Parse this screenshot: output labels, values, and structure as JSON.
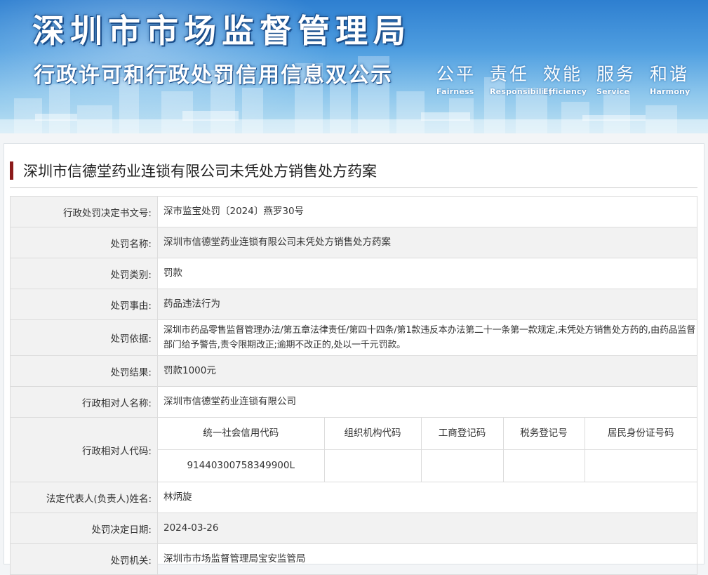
{
  "banner": {
    "title": "深圳市市场监督管理局",
    "subtitle": "行政许可和行政处罚信用信息双公示",
    "motto": [
      {
        "zh": "公平",
        "en": "Fairness"
      },
      {
        "zh": "责任",
        "en": "Responsibility"
      },
      {
        "zh": "效能",
        "en": "Efficiency"
      },
      {
        "zh": "服务",
        "en": "Service"
      },
      {
        "zh": "和谐",
        "en": "Harmony"
      }
    ]
  },
  "heading": "深圳市信德堂药业连锁有限公司未凭处方销售处方药案",
  "colors": {
    "accent_bar": "#8b1a1a",
    "label_bg": "#f2f2f2",
    "border": "#dcdcdc"
  },
  "rows": {
    "doc_no": {
      "label": "行政处罚决定书文号:",
      "value": "深市监宝处罚〔2024〕燕罗30号"
    },
    "name": {
      "label": "处罚名称:",
      "value": "深圳市信德堂药业连锁有限公司未凭处方销售处方药案"
    },
    "category": {
      "label": "处罚类别:",
      "value": "罚款"
    },
    "reason": {
      "label": "处罚事由:",
      "value": "药品违法行为"
    },
    "basis": {
      "label": "处罚依据:",
      "value": "深圳市药品零售监督管理办法/第五章法律责任/第四十四条/第1款违反本办法第二十一条第一款规定,未凭处方销售处方药的,由药品监督部门给予警告,责令限期改正;逾期不改正的,处以一千元罚款。"
    },
    "result": {
      "label": "处罚结果:",
      "value": "罚款1000元"
    },
    "party_name": {
      "label": "行政相对人名称:",
      "value": "深圳市信德堂药业连锁有限公司"
    },
    "party_code": {
      "label": "行政相对人代码:",
      "headers": [
        "统一社会信用代码",
        "组织机构代码",
        "工商登记码",
        "税务登记号",
        "居民身份证号码"
      ],
      "values": [
        "91440300758349900L",
        "",
        "",
        "",
        ""
      ]
    },
    "legal_rep": {
      "label": "法定代表人(负责人)姓名:",
      "value": "林炳旋"
    },
    "date": {
      "label": "处罚决定日期:",
      "value": "2024-03-26"
    },
    "authority": {
      "label": "处罚机关:",
      "value": "深圳市市场监督管理局宝安监管局"
    }
  }
}
